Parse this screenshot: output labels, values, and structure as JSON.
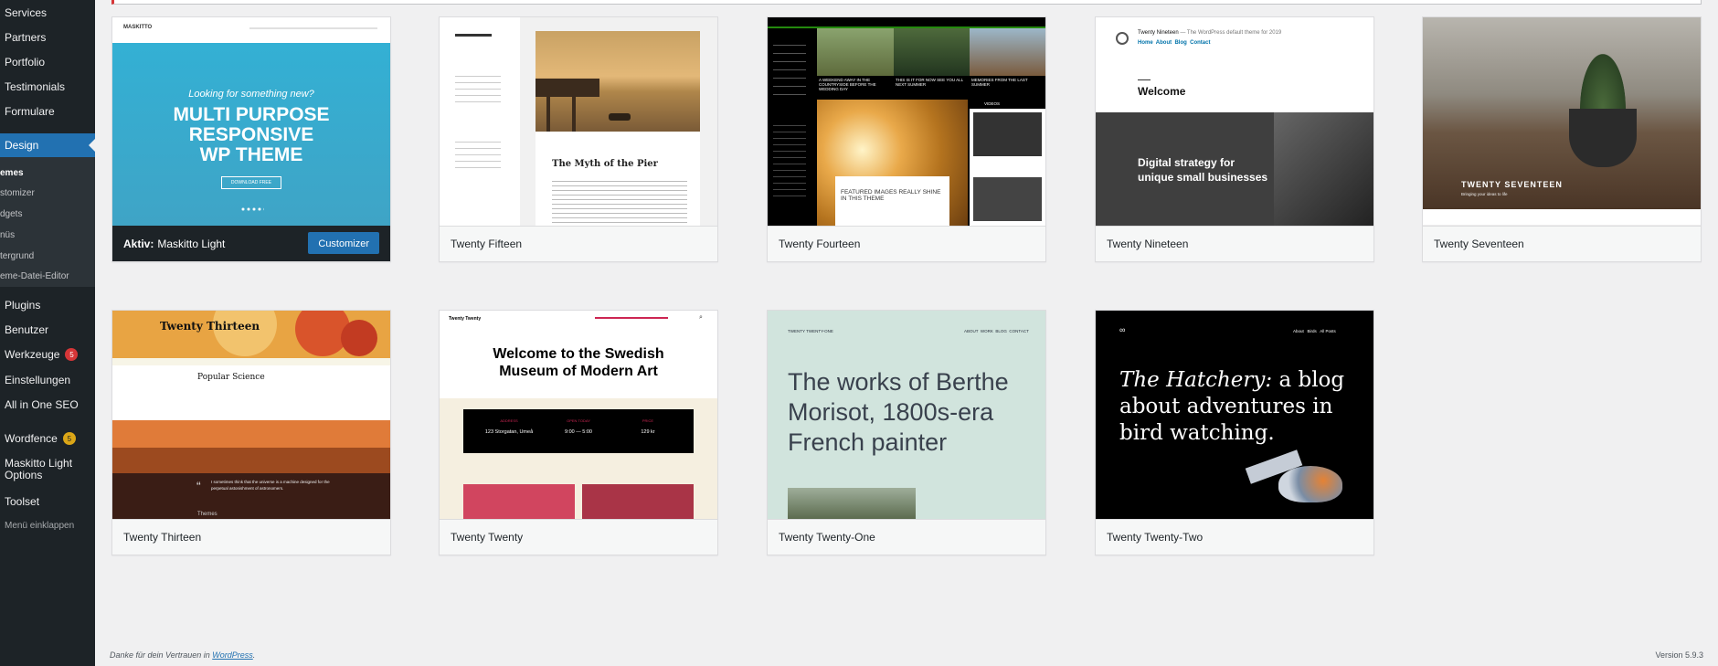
{
  "sidebar": {
    "items_top": [
      "Services",
      "Partners",
      "Portfolio",
      "Testimonials",
      "Formulare"
    ],
    "design_label": "Design",
    "submenu": [
      "emes",
      "stomizer",
      "dgets",
      "nüs",
      "tergrund",
      "eme-Datei-Editor"
    ],
    "items_bottom": [
      "Plugins",
      "Benutzer",
      "Werkzeuge",
      "Einstellungen",
      "All in One SEO",
      "Wordfence",
      "Maskitto Light",
      "Options",
      "Toolset"
    ],
    "werkzeuge_badge": "5",
    "wordfence_badge": "5",
    "collapse_label": "Menü einklappen"
  },
  "themes": [
    {
      "name": "Maskitto Light",
      "active_prefix": "Aktiv:",
      "button": "Customizer"
    },
    {
      "name": "Twenty Fifteen"
    },
    {
      "name": "Twenty Fourteen"
    },
    {
      "name": "Twenty Nineteen"
    },
    {
      "name": "Twenty Seventeen"
    },
    {
      "name": "Twenty Thirteen"
    },
    {
      "name": "Twenty Twenty"
    },
    {
      "name": "Twenty Twenty-One"
    },
    {
      "name": "Twenty Twenty-Two"
    }
  ],
  "previews": {
    "maskitto": {
      "logo": "MASKITTO",
      "tagline": "Looking for something new?",
      "headline_1": "MULTI PURPOSE",
      "headline_2": "RESPONSIVE",
      "headline_3": "WP THEME",
      "cta": "DOWNLOAD FREE"
    },
    "fifteen": {
      "post_title": "The Myth of the Pier"
    },
    "fourteen": {
      "caption_1": "A WEEKEND AWAY IN THE COUNTRYSIDE BEFORE THE WEDDING DAY",
      "caption_2": "THIS IS IT FOR NOW SEE YOU ALL NEXT SUMMER",
      "caption_3": "MEMORIES FROM THE LAST SUMMER",
      "feature": "FEATURED IMAGES REALLY SHINE IN THIS THEME",
      "videos": "VIDEOS"
    },
    "nineteen": {
      "site": "Twenty Nineteen",
      "tagline": "— The WordPress default theme for 2019",
      "nav": "Home  About  Blog  Contact",
      "welcome": "Welcome",
      "headline_1": "Digital strategy for",
      "headline_2": "unique small businesses"
    },
    "seventeen": {
      "title": "TWENTY SEVENTEEN",
      "sub": "Bringing your ideas to life"
    },
    "thirteen": {
      "site": "Twenty Thirteen",
      "post_title": "Popular Science",
      "quote": "I sometimes think that the universe is a machine designed for the perpetual astonishment of astronomers.",
      "more": "Themes"
    },
    "twenty": {
      "site": "Twenty Twenty",
      "headline_1": "Welcome to the Swedish",
      "headline_2": "Museum of Modern Art",
      "col1_label": "ADDRESS",
      "col1_value": "123 Storgatan, Umeå",
      "col2_label": "OPEN TODAY",
      "col2_value": "9:00 — 5:00",
      "col3_label": "PRICE",
      "col3_value": "129 kr"
    },
    "twentyone": {
      "site": "TWENTY TWENTY-ONE",
      "nav": "ABOUT  WORK  BLOG  CONTACT",
      "headline_1": "The works of Berthe",
      "headline_2": "Morisot, 1800s-era",
      "headline_3": "French painter"
    },
    "twentytwo": {
      "nav": "About   Birds   All Posts",
      "headline_italic": "The Hatchery:",
      "headline_rest": " a blog",
      "headline_2": "about adventures in",
      "headline_3": "bird watching."
    }
  },
  "footer": {
    "thanks_text": "Danke für dein Vertrauen in ",
    "link": "WordPress",
    "thanks_end": ".",
    "version": "Version 5.9.3"
  },
  "colors": {
    "admin_blue": "#2271b1",
    "sidebar_bg": "#1d2327",
    "alert_red": "#d63638"
  }
}
